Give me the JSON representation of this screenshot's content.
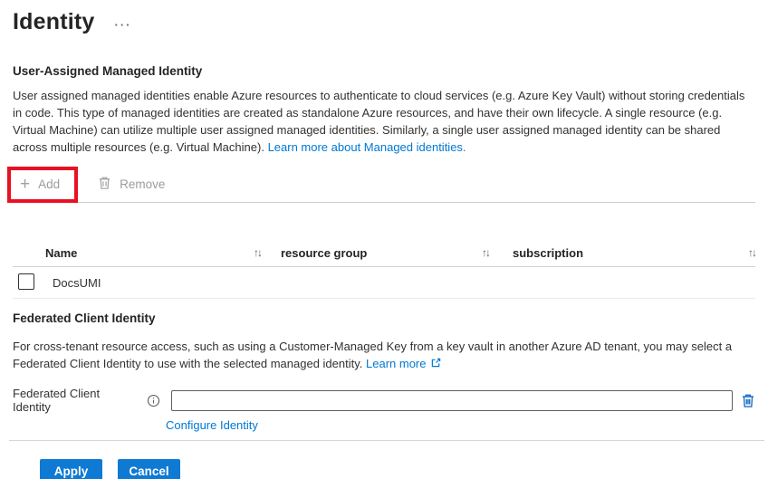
{
  "page": {
    "title": "Identity",
    "more_label": "···"
  },
  "user_assigned_section": {
    "heading": "User-Assigned Managed Identity",
    "description": "User assigned managed identities enable Azure resources to authenticate to cloud services (e.g. Azure Key Vault) without storing credentials in code. This type of managed identities are created as standalone Azure resources, and have their own lifecycle. A single resource (e.g. Virtual Machine) can utilize multiple user assigned managed identities. Similarly, a single user assigned managed identity can be shared across multiple resources (e.g. Virtual Machine).",
    "learn_more_link": "Learn more about Managed identities.",
    "toolbar": {
      "add_label": "Add",
      "remove_label": "Remove"
    },
    "table": {
      "columns": [
        "Name",
        "resource group",
        "subscription"
      ],
      "rows": [
        {
          "name": "DocsUMI",
          "checked": false,
          "resource_group": "",
          "subscription": ""
        }
      ]
    }
  },
  "federated_section": {
    "heading": "Federated Client Identity",
    "description": "For cross-tenant resource access, such as using a Customer-Managed Key from a key vault in another Azure AD tenant, you may select a Federated Client Identity to use with the selected managed identity.",
    "learn_more_link": "Learn more",
    "field_label": "Federated Client Identity",
    "input_value": "",
    "configure_link": "Configure Identity"
  },
  "footer": {
    "apply_label": "Apply",
    "cancel_label": "Cancel"
  },
  "icons": {
    "plus": "+",
    "sort": "↑↓"
  },
  "colors": {
    "accent_blue": "#0078d4",
    "annotation_red": "#e81123",
    "disabled_text": "#9e9c9a",
    "heading_text": "#242424",
    "body_text": "#323130"
  }
}
